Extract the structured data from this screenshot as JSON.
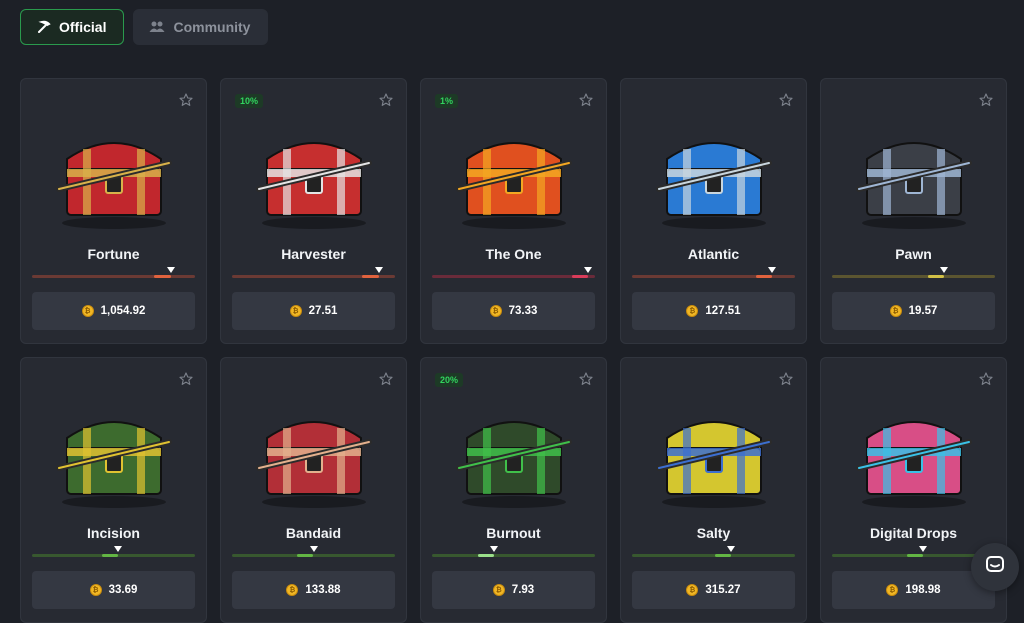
{
  "tabs": {
    "official": {
      "label": "Official",
      "icon": "pickaxe-icon",
      "active": true
    },
    "community": {
      "label": "Community",
      "icon": "community-icon",
      "active": false
    }
  },
  "colors": {
    "accent_green": "#2a9a4d",
    "badge_green": "#31d45e",
    "coin_gold": "#f0b624"
  },
  "cases": [
    {
      "name": "Fortune",
      "price": "1,054.92",
      "badge": "",
      "risk": 0.85,
      "bar_color": "#e0623e",
      "track_color": "#6b3a34",
      "art_color": "#c1272d",
      "art_trim": "#d8b24a"
    },
    {
      "name": "Harvester",
      "price": "27.51",
      "badge": "10%",
      "risk": 0.9,
      "bar_color": "#e0623e",
      "track_color": "#6b3a34",
      "art_color": "#c62f2f",
      "art_trim": "#e4e4e4"
    },
    {
      "name": "The One",
      "price": "73.33",
      "badge": "1%",
      "risk": 0.96,
      "bar_color": "#d93c5a",
      "track_color": "#6a2b3a",
      "art_color": "#e0501f",
      "art_trim": "#f3a722"
    },
    {
      "name": "Atlantic",
      "price": "127.51",
      "badge": "",
      "risk": 0.86,
      "bar_color": "#e0623e",
      "track_color": "#6b3a34",
      "art_color": "#2a7ad3",
      "art_trim": "#c9d6de"
    },
    {
      "name": "Pawn",
      "price": "19.57",
      "badge": "",
      "risk": 0.69,
      "bar_color": "#d1c047",
      "track_color": "#5b5530",
      "art_color": "#3b3f47",
      "art_trim": "#9fb6d4"
    },
    {
      "name": "Incision",
      "price": "33.69",
      "badge": "",
      "risk": 0.53,
      "bar_color": "#63b544",
      "track_color": "#38582f",
      "art_color": "#3d6b2e",
      "art_trim": "#e0c231"
    },
    {
      "name": "Bandaid",
      "price": "133.88",
      "badge": "",
      "risk": 0.5,
      "bar_color": "#63b544",
      "track_color": "#38582f",
      "art_color": "#b22f37",
      "art_trim": "#e3b08d"
    },
    {
      "name": "Burnout",
      "price": "7.93",
      "badge": "20%",
      "risk": 0.38,
      "bar_color": "#9adf8a",
      "track_color": "#38582f",
      "art_color": "#2f4a2a",
      "art_trim": "#40c04a"
    },
    {
      "name": "Salty",
      "price": "315.27",
      "badge": "",
      "risk": 0.61,
      "bar_color": "#63b544",
      "track_color": "#38582f",
      "art_color": "#d4c62f",
      "art_trim": "#3c6fd0"
    },
    {
      "name": "Digital Drops",
      "price": "198.98",
      "badge": "",
      "risk": 0.56,
      "bar_color": "#63b544",
      "track_color": "#38582f",
      "art_color": "#d84e86",
      "art_trim": "#3ac1e6"
    }
  ],
  "chat": {
    "icon": "chat-icon"
  }
}
